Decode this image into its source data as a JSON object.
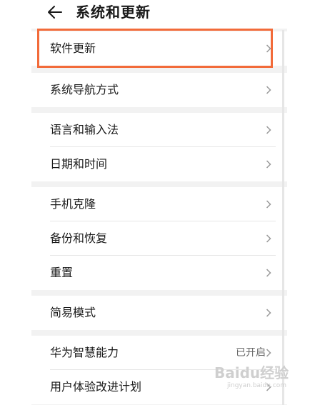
{
  "header": {
    "title": "系统和更新",
    "back_icon": "arrow-left-icon"
  },
  "groups": [
    {
      "items": [
        {
          "label": "软件更新",
          "value": ""
        }
      ]
    },
    {
      "items": [
        {
          "label": "系统导航方式",
          "value": ""
        }
      ]
    },
    {
      "items": [
        {
          "label": "语言和输入法",
          "value": ""
        },
        {
          "label": "日期和时间",
          "value": ""
        }
      ]
    },
    {
      "items": [
        {
          "label": "手机克隆",
          "value": ""
        },
        {
          "label": "备份和恢复",
          "value": ""
        },
        {
          "label": "重置",
          "value": ""
        }
      ]
    },
    {
      "items": [
        {
          "label": "简易模式",
          "value": ""
        }
      ]
    },
    {
      "items": [
        {
          "label": "华为智慧能力",
          "value": "已开启"
        },
        {
          "label": "用户体验改进计划",
          "value": ""
        }
      ]
    }
  ],
  "highlight_color": "#f26b3a",
  "watermark": {
    "main": "Baidu经验",
    "sub": "jingyan.baidu.com"
  }
}
